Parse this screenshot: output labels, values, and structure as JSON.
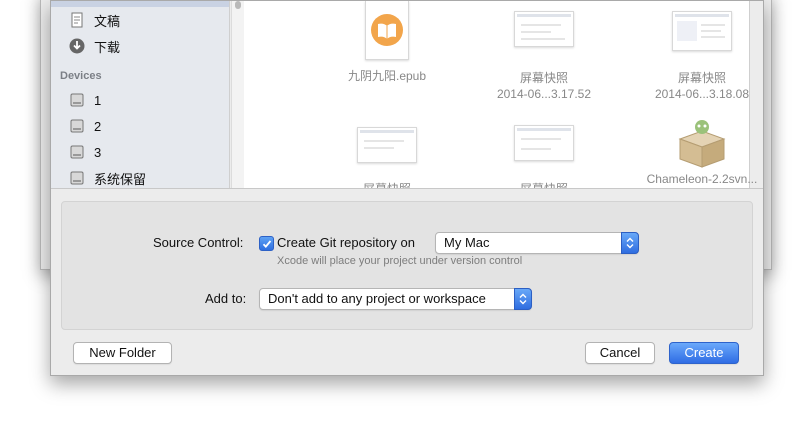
{
  "sidebar": {
    "items_top": [
      {
        "label": "文稿",
        "icon": "document-icon"
      },
      {
        "label": "下载",
        "icon": "download-icon"
      }
    ],
    "section_title": "Devices",
    "devices": [
      {
        "label": "1",
        "icon": "disk-icon"
      },
      {
        "label": "2",
        "icon": "disk-icon"
      },
      {
        "label": "3",
        "icon": "disk-icon"
      },
      {
        "label": "系统保留",
        "icon": "disk-icon"
      }
    ]
  },
  "files": [
    {
      "name": "九阴九阳.epub",
      "sub": "",
      "kind": "ibooks"
    },
    {
      "name": "屏幕快照",
      "sub": "2014-06...3.17.52",
      "kind": "screenshot"
    },
    {
      "name": "屏幕快照",
      "sub": "2014-06...3.18.08",
      "kind": "screenshot"
    },
    {
      "name": "屏幕快照",
      "sub": "",
      "kind": "screenshot"
    },
    {
      "name": "屏幕快照",
      "sub": "",
      "kind": "screenshot"
    },
    {
      "name": "Chameleon-2.2svn...",
      "sub": "",
      "kind": "package"
    }
  ],
  "form": {
    "source_control_label": "Source Control:",
    "create_git_label": "Create Git repository on",
    "create_git_checked": true,
    "git_location_value": "My Mac",
    "hint": "Xcode will place your project under version control",
    "add_to_label": "Add to:",
    "add_to_value": "Don't add to any project or workspace"
  },
  "buttons": {
    "new_folder": "New Folder",
    "cancel": "Cancel",
    "create": "Create"
  },
  "colors": {
    "accent": "#3a7ae8",
    "sidebar_bg": "#e6e9ee",
    "sheet_bg": "#ececec"
  }
}
